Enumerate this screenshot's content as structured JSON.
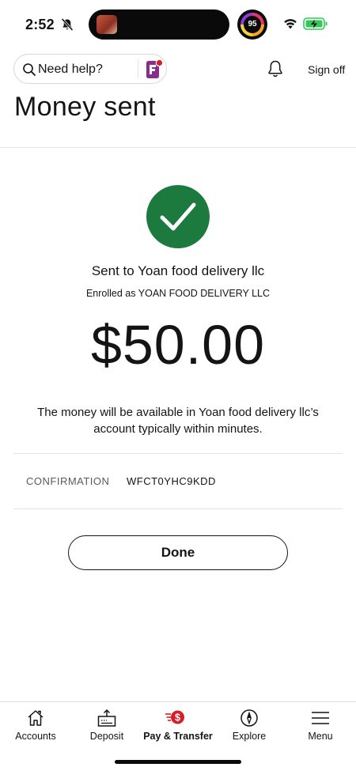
{
  "status_bar": {
    "time": "2:52",
    "activity_ring_value": "95"
  },
  "header": {
    "search_label": "Need help?",
    "sign_off": "Sign off"
  },
  "page": {
    "title": "Money sent"
  },
  "confirmation_card": {
    "sent_to": "Sent to Yoan food delivery llc",
    "enrolled_as": "Enrolled as YOAN FOOD DELIVERY LLC",
    "amount": "$50.00",
    "availability_text": "The money will be available in Yoan food delivery llc’s account typically within minutes.",
    "confirmation_label": "CONFIRMATION",
    "confirmation_number": "WFCT0YHC9KDD",
    "done_label": "Done"
  },
  "tab_bar": {
    "tabs": [
      {
        "label": "Accounts",
        "icon": "home-icon"
      },
      {
        "label": "Deposit",
        "icon": "deposit-icon"
      },
      {
        "label": "Pay & Transfer",
        "icon": "pay-transfer-icon",
        "active": true
      },
      {
        "label": "Explore",
        "icon": "compass-icon"
      },
      {
        "label": "Menu",
        "icon": "menu-icon"
      }
    ]
  },
  "colors": {
    "success_green": "#1c7a3e",
    "brand_red": "#d71e28",
    "brand_purple": "#8a2b8e"
  }
}
